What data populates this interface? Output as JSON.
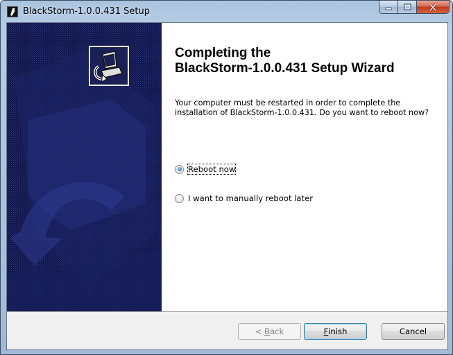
{
  "window": {
    "title": "BlackStorm-1.0.0.431 Setup",
    "icon": "blackstorm-app-icon"
  },
  "caption_buttons": {
    "minimize_icon": "minimize-icon",
    "maximize_icon": "maximize-icon",
    "close_icon": "close-icon"
  },
  "banner": {
    "icon": "computer-install-icon",
    "background_color": "#13184f"
  },
  "main": {
    "heading_line1": "Completing the",
    "heading_line2": "BlackStorm-1.0.0.431 Setup Wizard",
    "description": "Your computer must be restarted in order to complete the installation of BlackStorm-1.0.0.431. Do you want to reboot now?",
    "options": [
      {
        "label": "Reboot now",
        "selected": true
      },
      {
        "label": "I want to manually reboot later",
        "selected": false
      }
    ]
  },
  "buttons": {
    "back_prefix": "< ",
    "back_mnemonic": "B",
    "back_rest": "ack",
    "finish_mnemonic": "F",
    "finish_rest": "inish",
    "cancel": "Cancel"
  }
}
